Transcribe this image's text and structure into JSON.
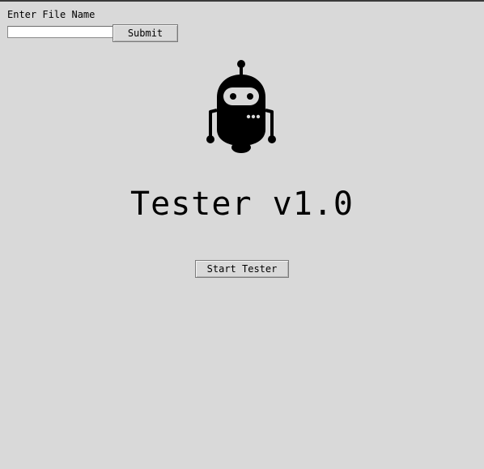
{
  "file_form": {
    "label": "Enter File Name",
    "input_value": "",
    "submit_label": "Submit"
  },
  "main": {
    "logo_icon": "robot-icon",
    "title": "Tester v1.0",
    "start_label": "Start Tester"
  },
  "colors": {
    "background": "#d9d9d9",
    "text": "#000000",
    "input_background": "#ffffff"
  }
}
